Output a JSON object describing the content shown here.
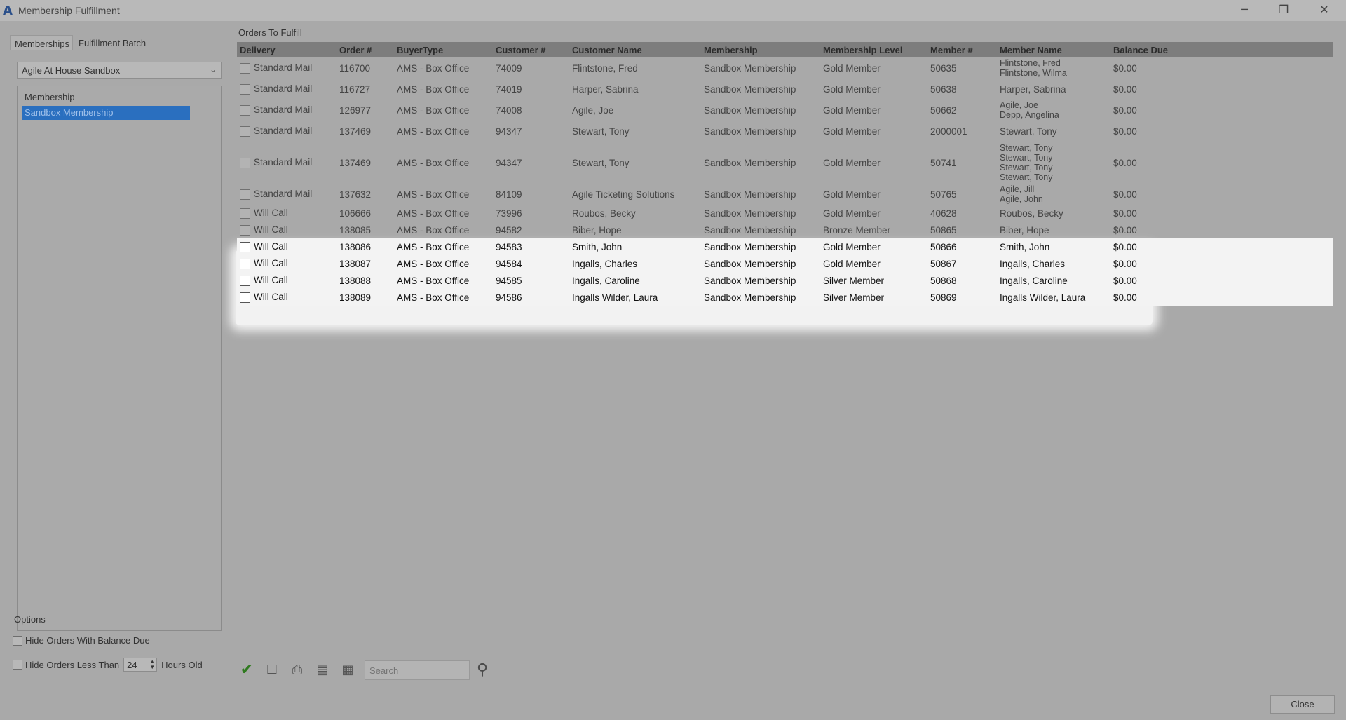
{
  "window": {
    "title": "Membership Fulfillment",
    "minimize": "─",
    "restore": "❐",
    "close": "✕"
  },
  "left": {
    "tabs": [
      "Memberships",
      "Fulfillment Batch"
    ],
    "combo_value": "Agile At House Sandbox",
    "list": [
      "Membership",
      "Sandbox Membership"
    ]
  },
  "options": {
    "label": "Options",
    "hide_balance": "Hide Orders With Balance Due",
    "hide_less_than": "Hide Orders Less Than",
    "hours_value": "24",
    "hours_old": "Hours Old"
  },
  "grid": {
    "group_label": "Orders To Fulfill",
    "columns": [
      "Delivery",
      "Order #",
      "BuyerType",
      "Customer #",
      "Customer Name",
      "Membership",
      "Membership Level",
      "Member #",
      "Member Name",
      "Balance Due"
    ],
    "rows": [
      {
        "delivery": "Standard Mail",
        "order": "116700",
        "buyer": "AMS - Box Office",
        "cust": "74009",
        "name": "Flintstone, Fred",
        "membership": "Sandbox Membership",
        "level": "Gold Member",
        "member": "50635",
        "member_name": "Flintstone, Fred\nFlintstone, Wilma",
        "balance": "$0.00"
      },
      {
        "delivery": "Standard Mail",
        "order": "116727",
        "buyer": "AMS - Box Office",
        "cust": "74019",
        "name": "Harper, Sabrina",
        "membership": "Sandbox Membership",
        "level": "Gold Member",
        "member": "50638",
        "member_name": "Harper, Sabrina",
        "balance": "$0.00"
      },
      {
        "delivery": "Standard Mail",
        "order": "126977",
        "buyer": "AMS - Box Office",
        "cust": "74008",
        "name": "Agile, Joe",
        "membership": "Sandbox Membership",
        "level": "Gold Member",
        "member": "50662",
        "member_name": "Agile, Joe\nDepp, Angelina",
        "balance": "$0.00"
      },
      {
        "delivery": "Standard Mail",
        "order": "137469",
        "buyer": "AMS - Box Office",
        "cust": "94347",
        "name": "Stewart, Tony",
        "membership": "Sandbox Membership",
        "level": "Gold Member",
        "member": "2000001",
        "member_name": "Stewart, Tony",
        "balance": "$0.00"
      },
      {
        "delivery": "Standard Mail",
        "order": "137469",
        "buyer": "AMS - Box Office",
        "cust": "94347",
        "name": "Stewart, Tony",
        "membership": "Sandbox Membership",
        "level": "Gold Member",
        "member": "50741",
        "member_name": "Stewart, Tony\nStewart, Tony\nStewart, Tony\nStewart, Tony",
        "balance": "$0.00"
      },
      {
        "delivery": "Standard Mail",
        "order": "137632",
        "buyer": "AMS - Box Office",
        "cust": "84109",
        "name": "Agile Ticketing Solutions",
        "membership": "Sandbox Membership",
        "level": "Gold Member",
        "member": "50765",
        "member_name": "Agile, Jill\nAgile, John",
        "balance": "$0.00"
      },
      {
        "delivery": "Will Call",
        "order": "106666",
        "buyer": "AMS - Box Office",
        "cust": "73996",
        "name": "Roubos, Becky",
        "membership": "Sandbox Membership",
        "level": "Gold Member",
        "member": "40628",
        "member_name": "Roubos, Becky",
        "balance": "$0.00"
      },
      {
        "delivery": "Will Call",
        "order": "138085",
        "buyer": "AMS - Box Office",
        "cust": "94582",
        "name": "Biber, Hope",
        "membership": "Sandbox Membership",
        "level": "Bronze Member",
        "member": "50865",
        "member_name": "Biber, Hope",
        "balance": "$0.00"
      },
      {
        "delivery": "Will Call",
        "order": "138086",
        "buyer": "AMS - Box Office",
        "cust": "94583",
        "name": "Smith, John",
        "membership": "Sandbox Membership",
        "level": "Gold Member",
        "member": "50866",
        "member_name": "Smith, John",
        "balance": "$0.00"
      },
      {
        "delivery": "Will Call",
        "order": "138087",
        "buyer": "AMS - Box Office",
        "cust": "94584",
        "name": "Ingalls, Charles",
        "membership": "Sandbox Membership",
        "level": "Gold Member",
        "member": "50867",
        "member_name": "Ingalls, Charles",
        "balance": "$0.00"
      },
      {
        "delivery": "Will Call",
        "order": "138088",
        "buyer": "AMS - Box Office",
        "cust": "94585",
        "name": "Ingalls, Caroline",
        "membership": "Sandbox Membership",
        "level": "Silver Member",
        "member": "50868",
        "member_name": "Ingalls, Caroline",
        "balance": "$0.00"
      },
      {
        "delivery": "Will Call",
        "order": "138089",
        "buyer": "AMS - Box Office",
        "cust": "94586",
        "name": "Ingalls Wilder, Laura",
        "membership": "Sandbox Membership",
        "level": "Silver Member",
        "member": "50869",
        "member_name": "Ingalls Wilder, Laura",
        "balance": "$0.00"
      }
    ]
  },
  "toolbar": {
    "search_placeholder": "Search",
    "icons": [
      "check-icon",
      "select-icon",
      "print-icon",
      "preview-icon",
      "export-icon",
      "search-icon"
    ]
  },
  "footer": {
    "close": "Close"
  }
}
